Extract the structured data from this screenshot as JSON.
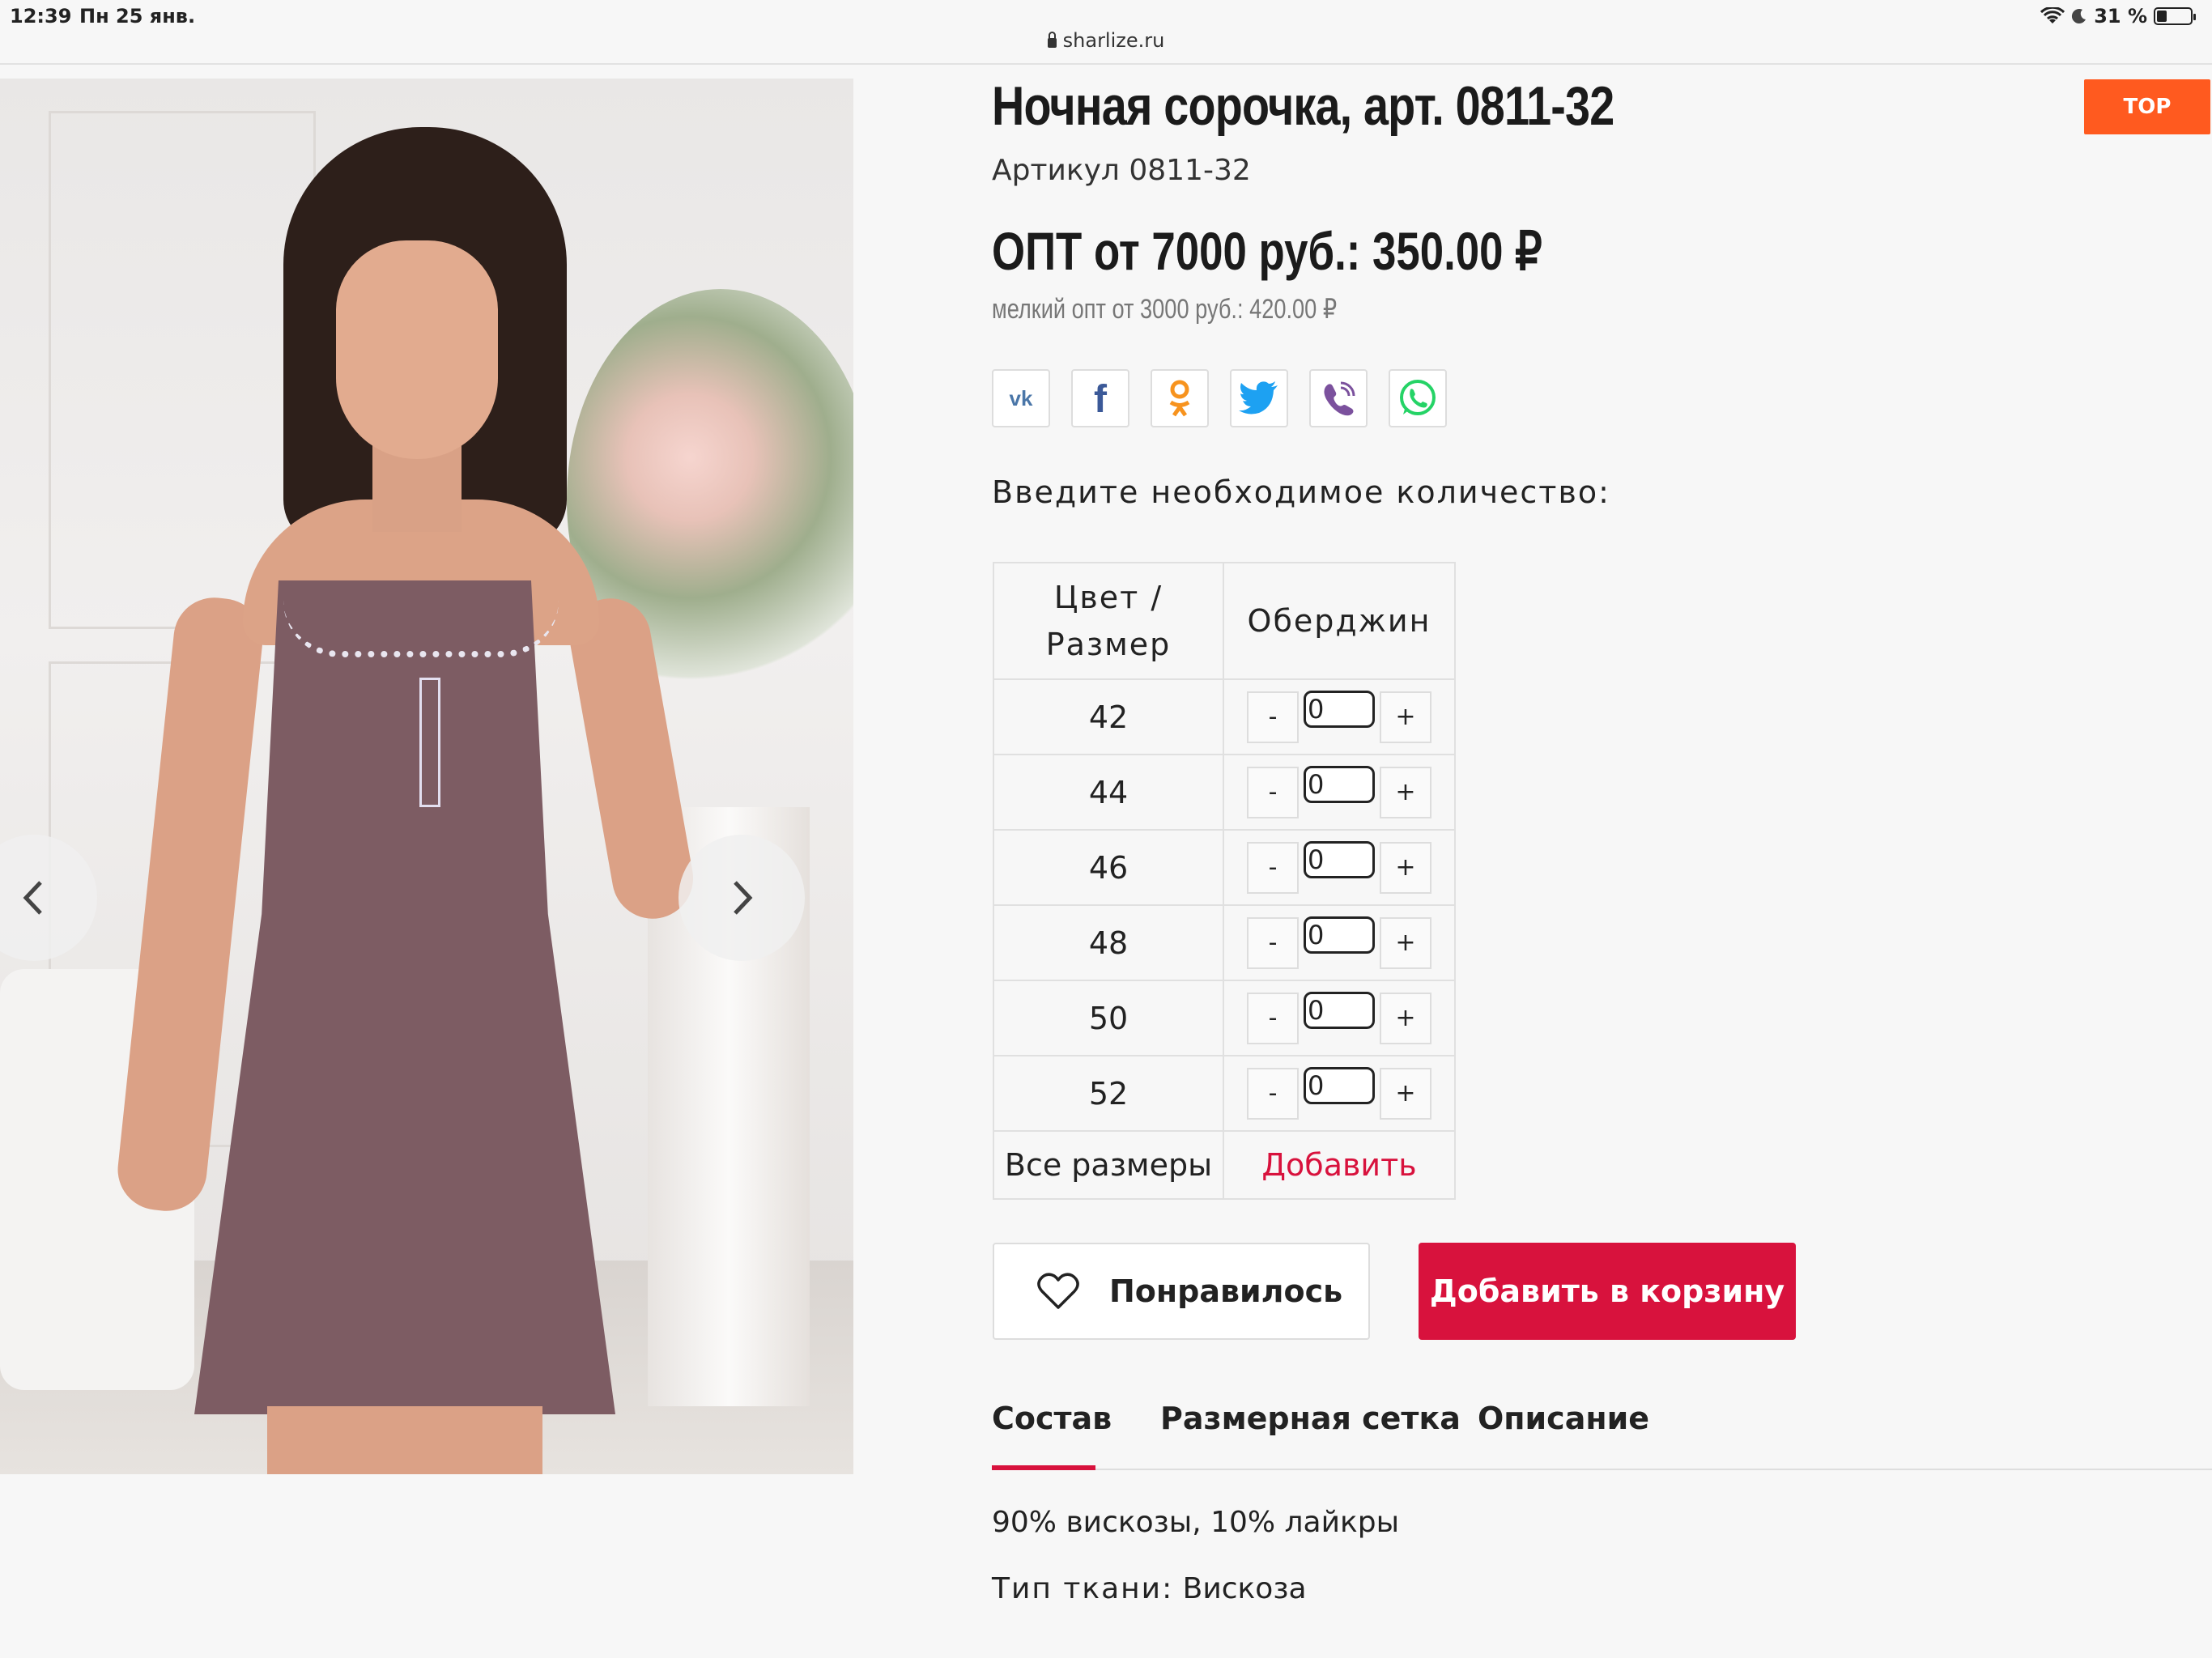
{
  "status_bar": {
    "time": "12:39",
    "date": "Пн 25 янв.",
    "battery": "31 %"
  },
  "url_bar": {
    "domain": "sharlize.ru"
  },
  "gallery": {
    "prev_icon": "chevron-left-icon",
    "next_icon": "chevron-right-icon"
  },
  "product": {
    "title": "Ночная сорочка, арт. 0811-32",
    "article": "Артикул 0811-32",
    "price": "ОПТ от 7000 руб.: 350.00 ₽",
    "price_small": "мелкий опт от 3000 руб.: 420.00 ₽"
  },
  "top_button": "TOP",
  "share": [
    "vk-icon",
    "facebook-icon",
    "odnoklassniki-icon",
    "twitter-icon",
    "viber-icon",
    "whatsapp-icon"
  ],
  "quantity": {
    "label": "Введите необходимое количество:",
    "header_col1": "Цвет / Размер",
    "header_col2": "Оберджин",
    "rows": [
      {
        "size": "42",
        "minus": "-",
        "value": "0",
        "plus": "+"
      },
      {
        "size": "44",
        "minus": "-",
        "value": "0",
        "plus": "+"
      },
      {
        "size": "46",
        "minus": "-",
        "value": "0",
        "plus": "+"
      },
      {
        "size": "48",
        "minus": "-",
        "value": "0",
        "plus": "+"
      },
      {
        "size": "50",
        "minus": "-",
        "value": "0",
        "plus": "+"
      },
      {
        "size": "52",
        "minus": "-",
        "value": "0",
        "plus": "+"
      }
    ],
    "all_sizes": "Все размеры",
    "add": "Добавить"
  },
  "actions": {
    "like": "Понравилось",
    "cart": "Добавить в корзину"
  },
  "tabs": [
    "Состав",
    "Размерная сетка",
    "Описание"
  ],
  "details": {
    "composition": "90% вискозы, 10% лайкры",
    "fabric_label": "Тип ткани:",
    "fabric_value": "Вискоза"
  },
  "colors": {
    "accent": "#d8123d",
    "top_button": "#ff5a1f"
  }
}
